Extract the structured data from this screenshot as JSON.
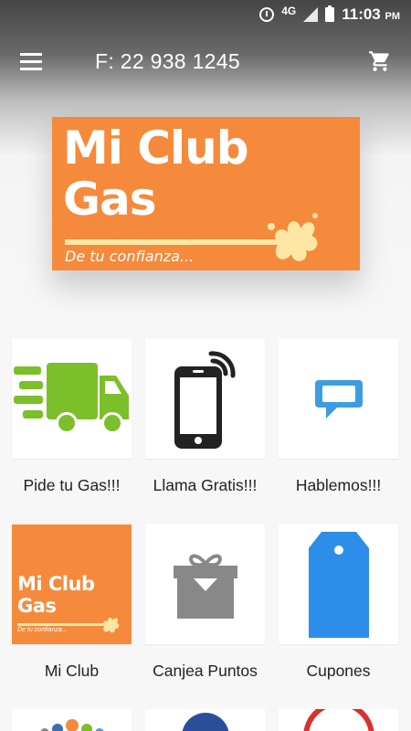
{
  "status_bar": {
    "network": "4G",
    "time": "11:03",
    "ampm": "PM"
  },
  "app_bar": {
    "phone": "F: 22 938 1245",
    "menu_icon": "hamburger-menu-icon",
    "cart_icon": "shopping-cart-icon"
  },
  "banner": {
    "line1": "Mi Club",
    "line2": "Gas",
    "tagline": "De tu confianza..."
  },
  "tiles": [
    {
      "label": "Pide tu Gas!!!",
      "icon": "delivery-truck-icon"
    },
    {
      "label": "Llama Gratis!!!",
      "icon": "mobile-phone-icon"
    },
    {
      "label": "Hablemos!!!",
      "icon": "chat-bubble-icon"
    },
    {
      "label": "Mi Club",
      "icon": "mi-club-gas-logo",
      "logo_line1": "Mi Club",
      "logo_line2": "Gas",
      "logo_tagline": "De tu confianza..."
    },
    {
      "label": "Canjea Puntos",
      "icon": "gift-box-icon"
    },
    {
      "label": "Cupones",
      "icon": "price-tag-icon"
    }
  ],
  "colors": {
    "brand_orange": "#f58a3c",
    "truck_green": "#7bbf2a",
    "chat_blue": "#3c9ee0",
    "tag_blue": "#2c8ee8"
  }
}
